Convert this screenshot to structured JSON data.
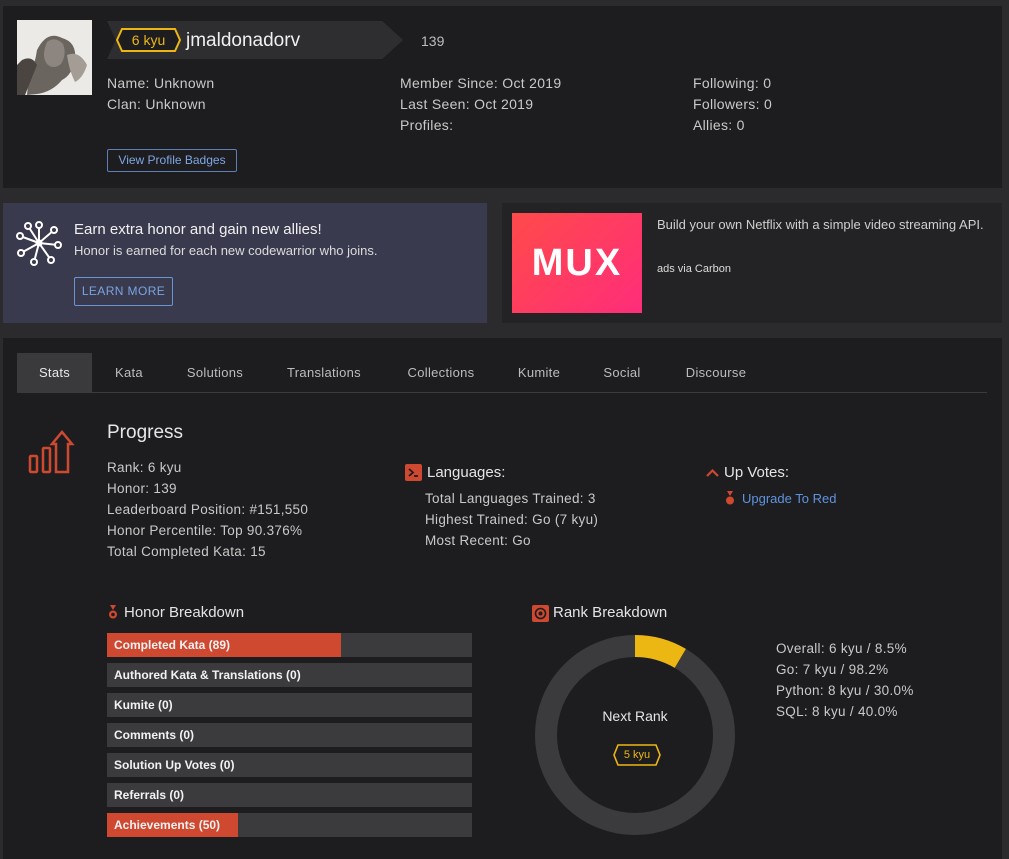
{
  "profile": {
    "rank": "6 kyu",
    "username": "jmaldonadorv",
    "honor": "139",
    "col1": [
      {
        "label": "Name:",
        "value": "Unknown"
      },
      {
        "label": "Clan:",
        "value": "Unknown"
      }
    ],
    "col2": [
      {
        "label": "Member Since:",
        "value": "Oct 2019"
      },
      {
        "label": "Last Seen:",
        "value": "Oct 2019"
      },
      {
        "label": "Profiles:",
        "value": ""
      }
    ],
    "col3": [
      {
        "label": "Following:",
        "value": "0"
      },
      {
        "label": "Followers:",
        "value": "0"
      },
      {
        "label": "Allies:",
        "value": "0"
      }
    ],
    "badges_button": "View Profile Badges"
  },
  "promo": {
    "title": "Earn extra honor and gain new allies!",
    "subtitle": "Honor is earned for each new codewarrior who joins.",
    "button": "LEARN MORE"
  },
  "ad": {
    "logo": "MUX",
    "text": "Build your own Netflix with a simple video streaming API.",
    "via": "ads via Carbon"
  },
  "tabs": [
    "Stats",
    "Kata",
    "Solutions",
    "Translations",
    "Collections",
    "Kumite",
    "Social",
    "Discourse"
  ],
  "progress": {
    "title": "Progress",
    "items": [
      {
        "label": "Rank:",
        "value": "6 kyu"
      },
      {
        "label": "Honor:",
        "value": "139"
      },
      {
        "label": "Leaderboard Position:",
        "value": "#151,550"
      },
      {
        "label": "Honor Percentile:",
        "value": "Top 90.376%"
      },
      {
        "label": "Total Completed Kata:",
        "value": "15"
      }
    ]
  },
  "languages": {
    "title": "Languages:",
    "items": [
      {
        "label": "Total Languages Trained:",
        "value": "3"
      },
      {
        "label": "Highest Trained:",
        "value": "Go (7 kyu)"
      },
      {
        "label": "Most Recent:",
        "value": "Go"
      }
    ]
  },
  "upvotes": {
    "title": "Up Votes:",
    "link": "Upgrade To Red"
  },
  "honor_breakdown": {
    "title": "Honor Breakdown",
    "items": [
      {
        "label": "Completed Kata (89)",
        "fill": 0.64
      },
      {
        "label": "Authored Kata & Translations (0)",
        "fill": 0
      },
      {
        "label": "Kumite (0)",
        "fill": 0
      },
      {
        "label": "Comments (0)",
        "fill": 0
      },
      {
        "label": "Solution Up Votes (0)",
        "fill": 0
      },
      {
        "label": "Referrals (0)",
        "fill": 0
      },
      {
        "label": "Achievements (50)",
        "fill": 0.36
      }
    ]
  },
  "rank_breakdown": {
    "title": "Rank Breakdown",
    "center_label": "Next Rank",
    "next_rank": "5 kyu",
    "progress": 0.085,
    "items": [
      {
        "label": "Overall:",
        "value": "6 kyu / 8.5%"
      },
      {
        "label": "Go:",
        "value": "7 kyu / 98.2%"
      },
      {
        "label": "Python:",
        "value": "8 kyu / 30.0%"
      },
      {
        "label": "SQL:",
        "value": "8 kyu / 40.0%"
      }
    ]
  },
  "colors": {
    "accent_red": "#cf4830",
    "kyu_yellow": "#ecb613",
    "link_blue": "#5f93e0"
  }
}
